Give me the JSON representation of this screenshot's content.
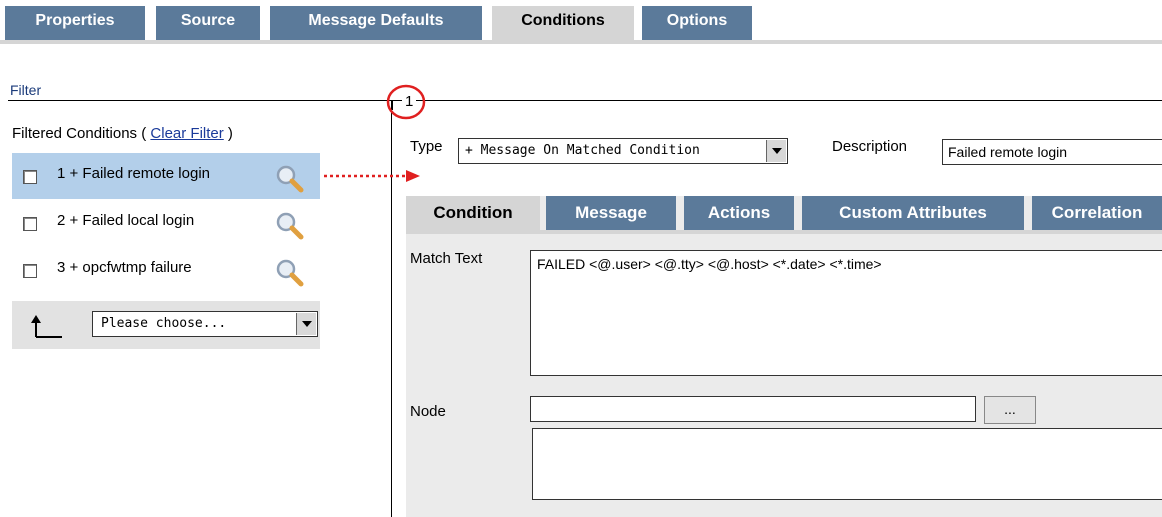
{
  "tabs": [
    "Properties",
    "Source",
    "Message Defaults",
    "Conditions",
    "Options"
  ],
  "active_tab": "Conditions",
  "filter": {
    "title": "Filter",
    "label_prefix": "Filtered Conditions ( ",
    "clear_link": "Clear Filter",
    "label_suffix": " )"
  },
  "conditions": [
    {
      "text": "1 + Failed remote login",
      "selected": true
    },
    {
      "text": "2 + Failed local login",
      "selected": false
    },
    {
      "text": "3 + opcfwtmp failure",
      "selected": false
    }
  ],
  "chooser": {
    "value": "Please choose..."
  },
  "condition_group": {
    "number": "1"
  },
  "type": {
    "label": "Type",
    "value": "+ Message On Matched Condition"
  },
  "description": {
    "label": "Description",
    "value": "Failed remote login"
  },
  "subtabs": [
    "Condition",
    "Message",
    "Actions",
    "Custom Attributes",
    "Correlation"
  ],
  "active_subtab": "Condition",
  "match_text": {
    "label": "Match Text",
    "value": "FAILED <@.user> <@.tty> <@.host> <*.date> <*.time>"
  },
  "node": {
    "label": "Node",
    "value": "",
    "browse_label": "..."
  },
  "colors": {
    "tab_blue": "#5b7a9a",
    "tab_active": "#d5d5d5",
    "selection": "#b3cfea",
    "annotation_red": "#e02020"
  },
  "icons": [
    "magnifier-icon",
    "up-arrow-icon",
    "dropdown-arrow-icon"
  ]
}
